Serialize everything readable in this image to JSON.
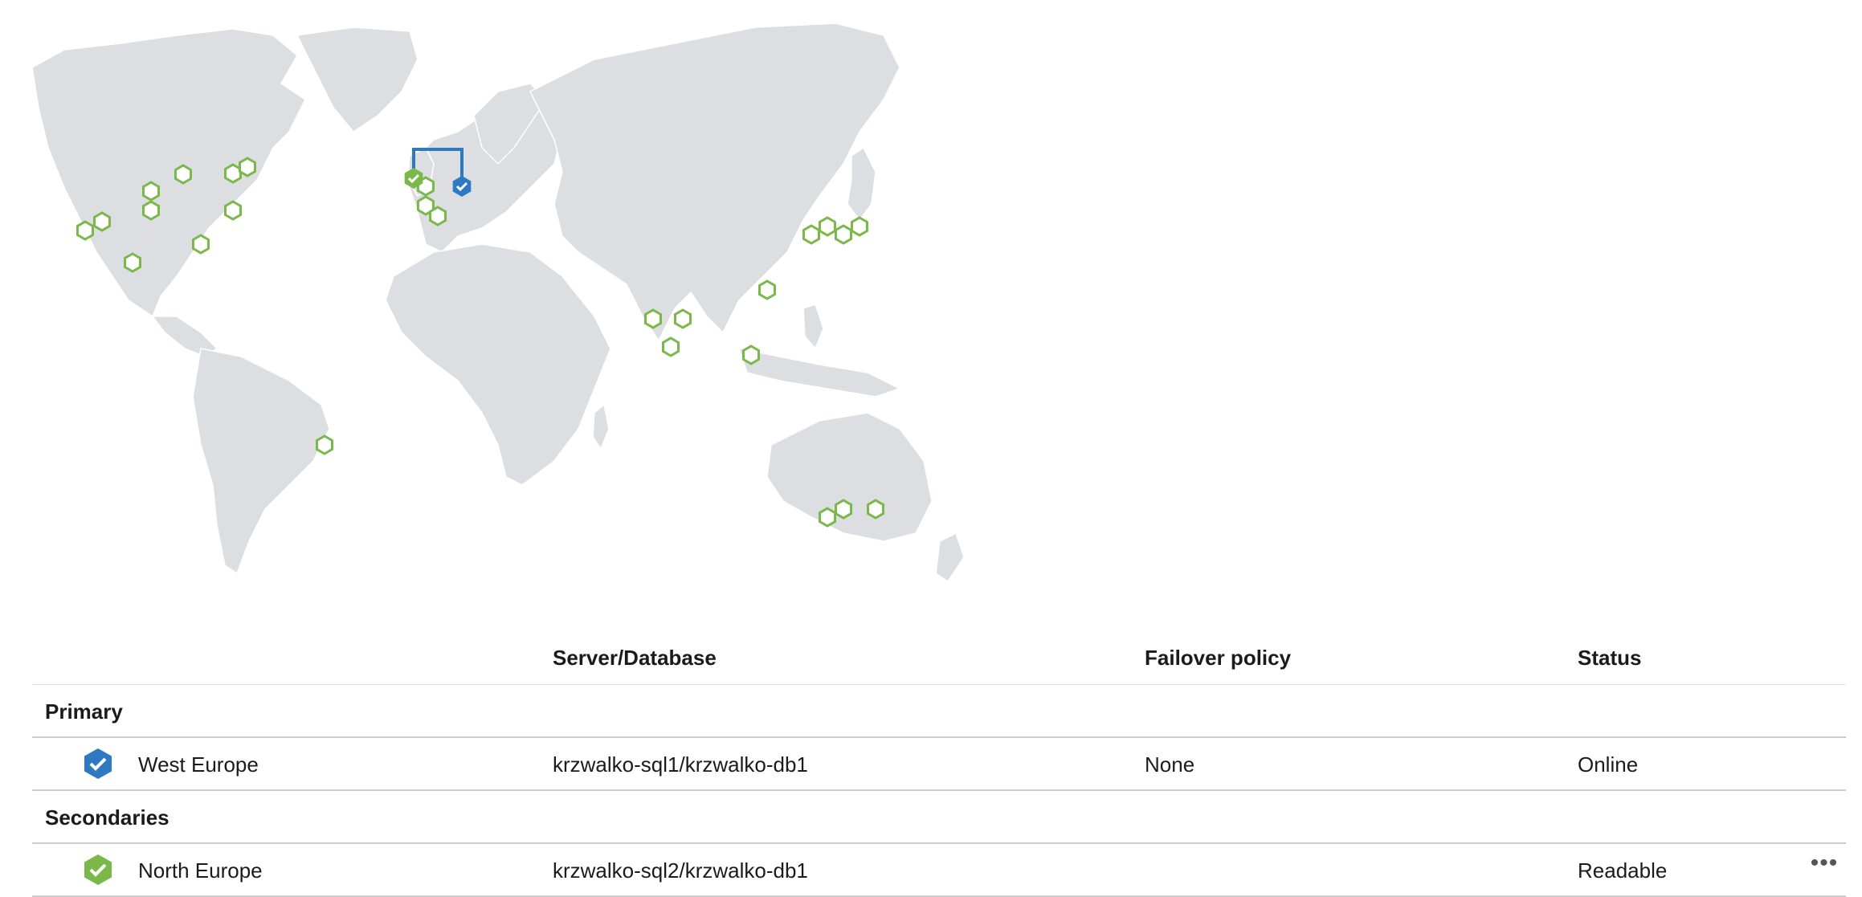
{
  "map": {
    "colors": {
      "land": "#dcdee2",
      "available_region": "#7ab84a",
      "primary": "#2f79c0",
      "secondary": "#7ab84a"
    },
    "icons": {
      "available_region": "hexagon-outline-icon",
      "primary_marker": "blue-check-hexagon-icon",
      "secondary_marker": "green-check-hexagon-icon"
    }
  },
  "grid": {
    "columns": {
      "region": "",
      "server_database": "Server/Database",
      "failover_policy": "Failover policy",
      "status": "Status"
    },
    "groups": [
      {
        "label": "Primary",
        "rows": [
          {
            "icon": "blue-check-hexagon-icon",
            "region": "West Europe",
            "server_database": "krzwalko-sql1/krzwalko-db1",
            "failover_policy": "None",
            "status": "Online",
            "has_more": false
          }
        ]
      },
      {
        "label": "Secondaries",
        "rows": [
          {
            "icon": "green-check-hexagon-icon",
            "region": "North Europe",
            "server_database": "krzwalko-sql2/krzwalko-db1",
            "failover_policy": "",
            "status": "Readable",
            "has_more": true,
            "more_label": "•••"
          }
        ]
      }
    ]
  }
}
